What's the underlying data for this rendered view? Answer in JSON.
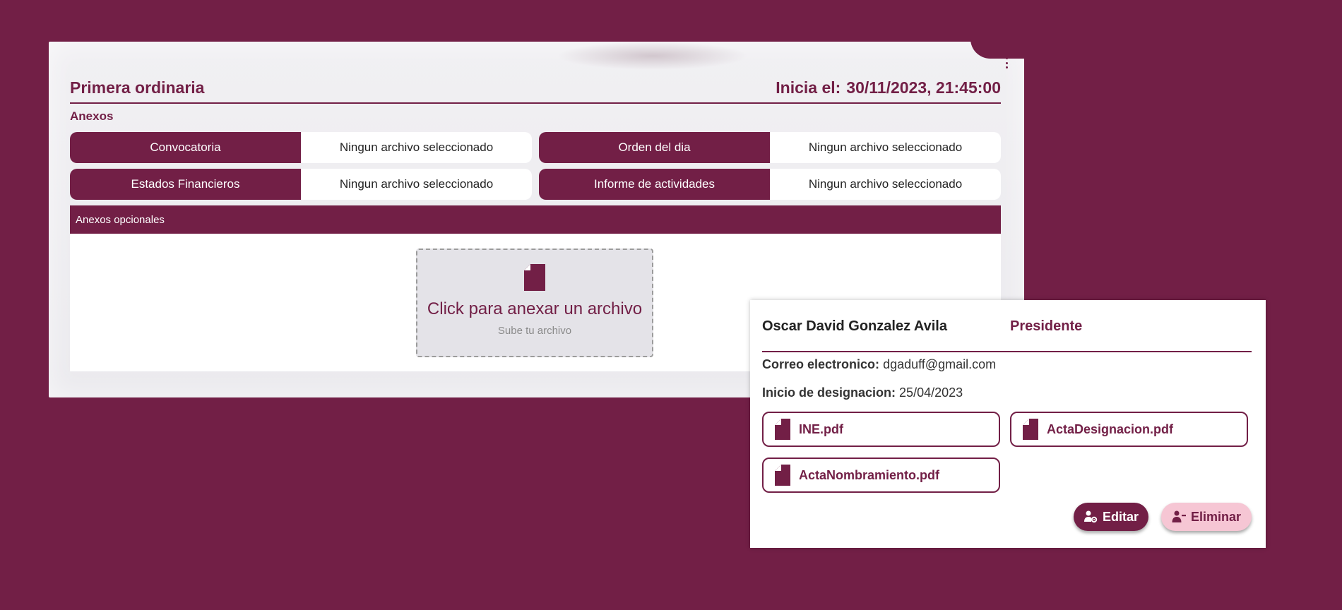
{
  "session": {
    "title": "Primera ordinaria",
    "start_label": "Inicia el:",
    "start_value": "30/11/2023, 21:45:00"
  },
  "annexes": {
    "label": "Anexos",
    "items": [
      {
        "button": "Convocatoria",
        "status": "Ningun archivo seleccionado"
      },
      {
        "button": "Orden del dia",
        "status": "Ningun archivo seleccionado"
      },
      {
        "button": "Estados Financieros",
        "status": "Ningun archivo seleccionado"
      },
      {
        "button": "Informe de actividades",
        "status": "Ningun archivo seleccionado"
      }
    ]
  },
  "optional": {
    "header": "Anexos opcionales",
    "dropzone_title": "Click para anexar un archivo",
    "dropzone_sub": "Sube tu archivo",
    "icon": "document-icon"
  },
  "person": {
    "name": "Oscar David Gonzalez Avila",
    "role": "Presidente",
    "email_label": "Correo electronico:",
    "email": "dgaduff@gmail.com",
    "designation_label": "Inicio de designacion:",
    "designation_date": "25/04/2023",
    "documents": [
      "INE.pdf",
      "ActaDesignacion.pdf",
      "ActaNombramiento.pdf"
    ],
    "edit_label": "Editar",
    "delete_label": "Eliminar"
  },
  "colors": {
    "brand": "#721f46",
    "panel": "#ebeaee",
    "delete_bg": "#f6c6d4"
  }
}
